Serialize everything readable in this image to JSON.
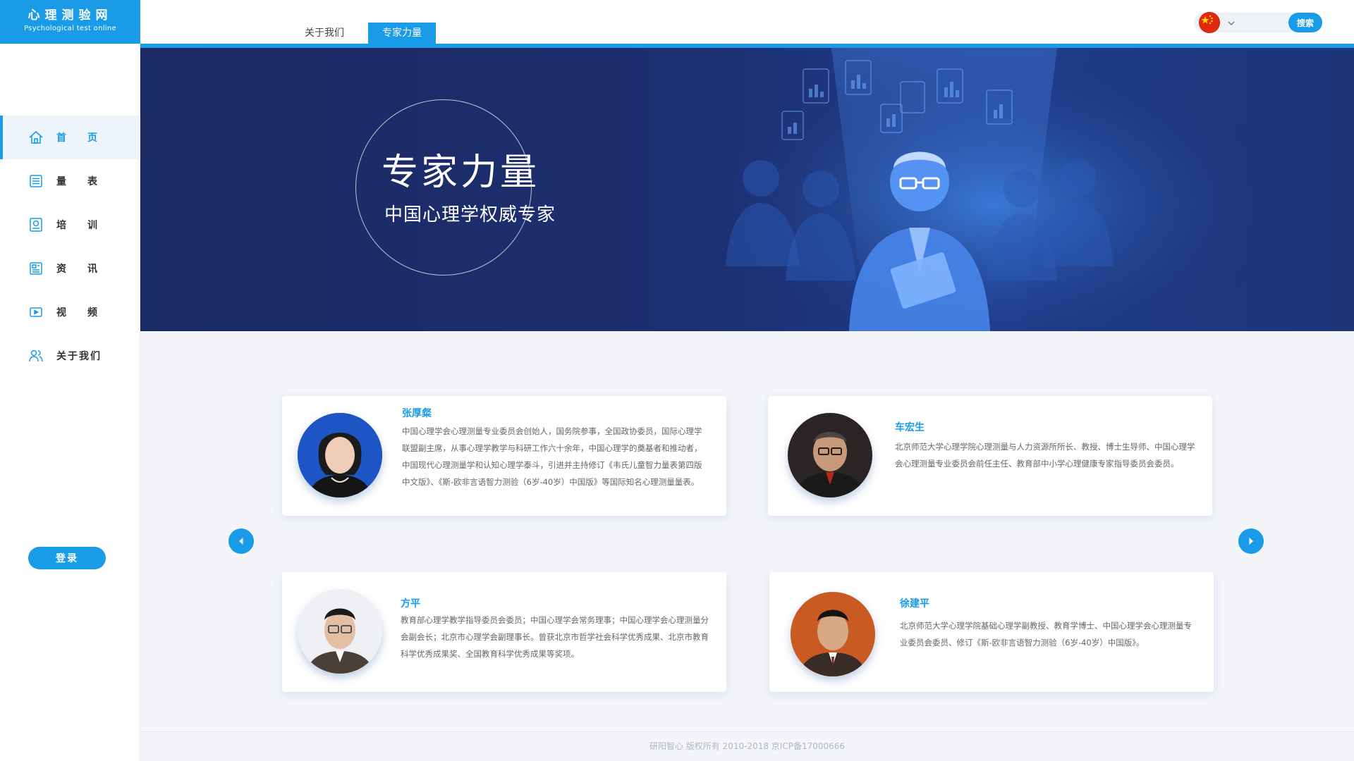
{
  "logo": {
    "title": "心理测验网",
    "subtitle": "Psychological test online"
  },
  "sidebar": {
    "items": [
      {
        "label": "首页",
        "icon": "home-icon",
        "active": true
      },
      {
        "label": "量表",
        "icon": "list-icon",
        "active": false
      },
      {
        "label": "培训",
        "icon": "training-icon",
        "active": false
      },
      {
        "label": "资讯",
        "icon": "news-icon",
        "active": false
      },
      {
        "label": "视频",
        "icon": "video-icon",
        "active": false
      },
      {
        "label": "关于我们",
        "icon": "users-icon",
        "active": false
      }
    ],
    "login_label": "登录"
  },
  "header": {
    "tabs": [
      {
        "label": "关于我们",
        "active": false
      },
      {
        "label": "专家力量",
        "active": true
      }
    ],
    "search": {
      "placeholder": "",
      "button_label": "搜索"
    },
    "language_icon": "china-flag-icon"
  },
  "banner": {
    "title": "专家力量",
    "subtitle": "中国心理学权威专家"
  },
  "experts": [
    {
      "name": "张厚粲",
      "desc": "中国心理学会心理测量专业委员会创始人，国务院参事，全国政协委员，国际心理学联盟副主席，从事心理学教学与科研工作六十余年，中国心理学的奠基者和推动者，中国现代心理测量学和认知心理学泰斗，引进并主持修订《韦氏儿童智力量表第四版中文版》、《斯-欧非言语智力测验（6岁-40岁）中国版》等国际知名心理测量量表。"
    },
    {
      "name": "车宏生",
      "desc": "北京师范大学心理学院心理测量与人力资源所所长、教授、博士生导师、中国心理学会心理测量专业委员会前任主任、教育部中小学心理健康专家指导委员会委员。"
    },
    {
      "name": "方平",
      "desc": "教育部心理学教学指导委员会委员；中国心理学会常务理事；中国心理学会心理测量分会副会长；北京市心理学会副理事长。曾获北京市哲学社会科学优秀成果、北京市教育科学优秀成果奖、全国教育科学优秀成果等奖项。"
    },
    {
      "name": "徐建平",
      "desc": "北京师范大学心理学院基础心理学副教授、教育学博士、中国心理学会心理测量专业委员会委员、修订《斯-欧非言语智力测验（6岁-40岁）中国版》。"
    }
  ],
  "footer": {
    "text": "研阳智心 版权所有 2010-2018 京ICP备17000666"
  },
  "colors": {
    "accent": "#1a9be8",
    "banner_bg": "#1c2f70"
  }
}
